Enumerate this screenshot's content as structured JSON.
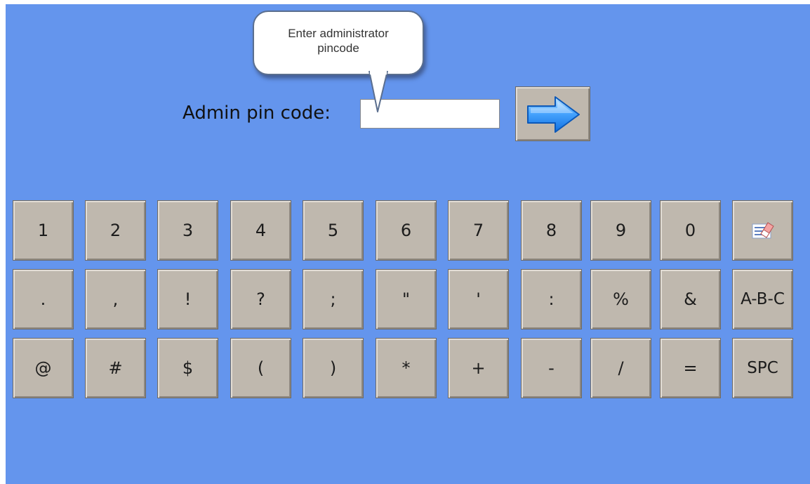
{
  "tooltip": {
    "text": "Enter administrator pincode"
  },
  "pin_entry": {
    "label": "Admin pin code:",
    "value": "",
    "submit_icon": "right-arrow-icon"
  },
  "keypad": {
    "rows": [
      [
        "1",
        "2",
        "3",
        "4",
        "5",
        "6",
        "7",
        "8",
        "9",
        "0",
        ""
      ],
      [
        ".",
        ",",
        "!",
        "?",
        ";",
        "\"",
        "'",
        ":",
        "%",
        "&",
        "A-B-C"
      ],
      [
        "@",
        "#",
        "$",
        "(",
        ")",
        "*",
        "+",
        "-",
        "/",
        "=",
        "SPC"
      ]
    ],
    "clear_icon": "eraser-icon"
  }
}
